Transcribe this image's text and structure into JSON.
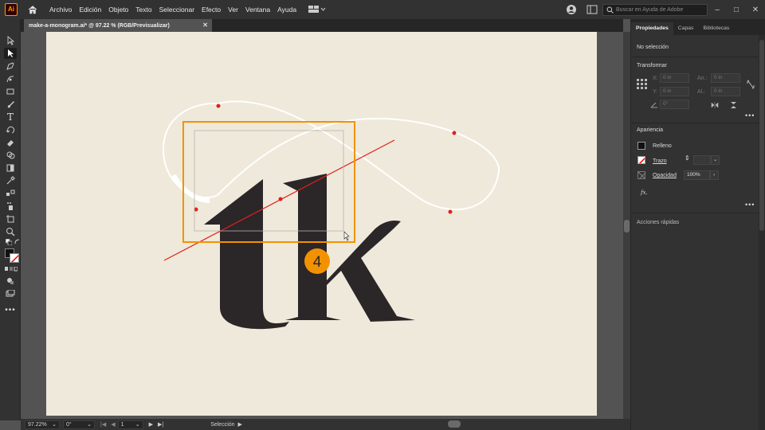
{
  "app": {
    "logo": "Ai",
    "accent": "#ff9a00"
  },
  "menu": [
    "Archivo",
    "Edición",
    "Objeto",
    "Texto",
    "Seleccionar",
    "Efecto",
    "Ver",
    "Ventana",
    "Ayuda"
  ],
  "search": {
    "placeholder": "Buscar en Ayuda de Adobe"
  },
  "document": {
    "tab_title": "make-a-monogram.ai* @ 97.22 % (RGB/Previsualizar)"
  },
  "artwork": {
    "letters": "tk",
    "step_badge": "4",
    "badge_color": "#f39200",
    "ink_color": "#2b2628",
    "artboard_color": "#eee9da"
  },
  "status": {
    "zoom": "97.22%",
    "rotation": "0°",
    "page": "1",
    "mode": "Selección"
  },
  "panel": {
    "tabs": [
      "Propiedades",
      "Capas",
      "Bibliotecas"
    ],
    "no_selection": "No selección",
    "transform": {
      "title": "Transformar",
      "x_label": "X:",
      "y_label": "Y:",
      "w_label": "An.:",
      "h_label": "Al.:",
      "x": "0 in",
      "y": "0 in",
      "w": "0 in",
      "h": "0 in",
      "angle": "0°"
    },
    "appearance": {
      "title": "Apariencia",
      "fill": "Relleno",
      "stroke": "Trazo",
      "opacity_label": "Opacidad",
      "opacity": "100%",
      "fx": "fx."
    },
    "quick_actions": "Acciones rápidas"
  }
}
